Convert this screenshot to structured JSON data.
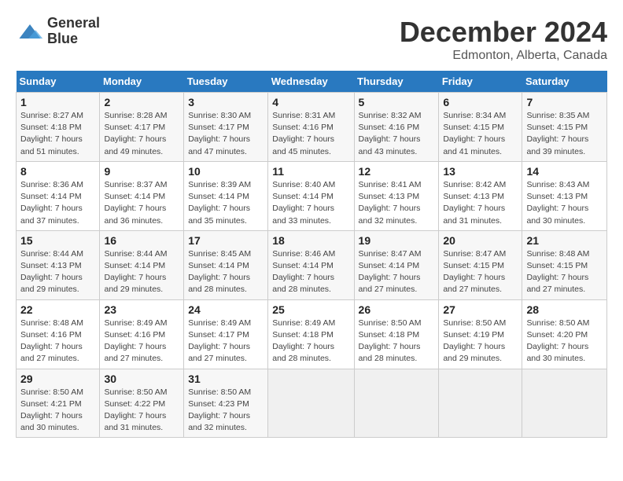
{
  "header": {
    "logo_line1": "General",
    "logo_line2": "Blue",
    "title": "December 2024",
    "subtitle": "Edmonton, Alberta, Canada"
  },
  "days_of_week": [
    "Sunday",
    "Monday",
    "Tuesday",
    "Wednesday",
    "Thursday",
    "Friday",
    "Saturday"
  ],
  "weeks": [
    [
      {
        "day": "1",
        "sunrise": "8:27 AM",
        "sunset": "4:18 PM",
        "daylight": "7 hours and 51 minutes."
      },
      {
        "day": "2",
        "sunrise": "8:28 AM",
        "sunset": "4:17 PM",
        "daylight": "7 hours and 49 minutes."
      },
      {
        "day": "3",
        "sunrise": "8:30 AM",
        "sunset": "4:17 PM",
        "daylight": "7 hours and 47 minutes."
      },
      {
        "day": "4",
        "sunrise": "8:31 AM",
        "sunset": "4:16 PM",
        "daylight": "7 hours and 45 minutes."
      },
      {
        "day": "5",
        "sunrise": "8:32 AM",
        "sunset": "4:16 PM",
        "daylight": "7 hours and 43 minutes."
      },
      {
        "day": "6",
        "sunrise": "8:34 AM",
        "sunset": "4:15 PM",
        "daylight": "7 hours and 41 minutes."
      },
      {
        "day": "7",
        "sunrise": "8:35 AM",
        "sunset": "4:15 PM",
        "daylight": "7 hours and 39 minutes."
      }
    ],
    [
      {
        "day": "8",
        "sunrise": "8:36 AM",
        "sunset": "4:14 PM",
        "daylight": "7 hours and 37 minutes."
      },
      {
        "day": "9",
        "sunrise": "8:37 AM",
        "sunset": "4:14 PM",
        "daylight": "7 hours and 36 minutes."
      },
      {
        "day": "10",
        "sunrise": "8:39 AM",
        "sunset": "4:14 PM",
        "daylight": "7 hours and 35 minutes."
      },
      {
        "day": "11",
        "sunrise": "8:40 AM",
        "sunset": "4:14 PM",
        "daylight": "7 hours and 33 minutes."
      },
      {
        "day": "12",
        "sunrise": "8:41 AM",
        "sunset": "4:13 PM",
        "daylight": "7 hours and 32 minutes."
      },
      {
        "day": "13",
        "sunrise": "8:42 AM",
        "sunset": "4:13 PM",
        "daylight": "7 hours and 31 minutes."
      },
      {
        "day": "14",
        "sunrise": "8:43 AM",
        "sunset": "4:13 PM",
        "daylight": "7 hours and 30 minutes."
      }
    ],
    [
      {
        "day": "15",
        "sunrise": "8:44 AM",
        "sunset": "4:13 PM",
        "daylight": "7 hours and 29 minutes."
      },
      {
        "day": "16",
        "sunrise": "8:44 AM",
        "sunset": "4:14 PM",
        "daylight": "7 hours and 29 minutes."
      },
      {
        "day": "17",
        "sunrise": "8:45 AM",
        "sunset": "4:14 PM",
        "daylight": "7 hours and 28 minutes."
      },
      {
        "day": "18",
        "sunrise": "8:46 AM",
        "sunset": "4:14 PM",
        "daylight": "7 hours and 28 minutes."
      },
      {
        "day": "19",
        "sunrise": "8:47 AM",
        "sunset": "4:14 PM",
        "daylight": "7 hours and 27 minutes."
      },
      {
        "day": "20",
        "sunrise": "8:47 AM",
        "sunset": "4:15 PM",
        "daylight": "7 hours and 27 minutes."
      },
      {
        "day": "21",
        "sunrise": "8:48 AM",
        "sunset": "4:15 PM",
        "daylight": "7 hours and 27 minutes."
      }
    ],
    [
      {
        "day": "22",
        "sunrise": "8:48 AM",
        "sunset": "4:16 PM",
        "daylight": "7 hours and 27 minutes."
      },
      {
        "day": "23",
        "sunrise": "8:49 AM",
        "sunset": "4:16 PM",
        "daylight": "7 hours and 27 minutes."
      },
      {
        "day": "24",
        "sunrise": "8:49 AM",
        "sunset": "4:17 PM",
        "daylight": "7 hours and 27 minutes."
      },
      {
        "day": "25",
        "sunrise": "8:49 AM",
        "sunset": "4:18 PM",
        "daylight": "7 hours and 28 minutes."
      },
      {
        "day": "26",
        "sunrise": "8:50 AM",
        "sunset": "4:18 PM",
        "daylight": "7 hours and 28 minutes."
      },
      {
        "day": "27",
        "sunrise": "8:50 AM",
        "sunset": "4:19 PM",
        "daylight": "7 hours and 29 minutes."
      },
      {
        "day": "28",
        "sunrise": "8:50 AM",
        "sunset": "4:20 PM",
        "daylight": "7 hours and 30 minutes."
      }
    ],
    [
      {
        "day": "29",
        "sunrise": "8:50 AM",
        "sunset": "4:21 PM",
        "daylight": "7 hours and 30 minutes."
      },
      {
        "day": "30",
        "sunrise": "8:50 AM",
        "sunset": "4:22 PM",
        "daylight": "7 hours and 31 minutes."
      },
      {
        "day": "31",
        "sunrise": "8:50 AM",
        "sunset": "4:23 PM",
        "daylight": "7 hours and 32 minutes."
      },
      null,
      null,
      null,
      null
    ]
  ]
}
